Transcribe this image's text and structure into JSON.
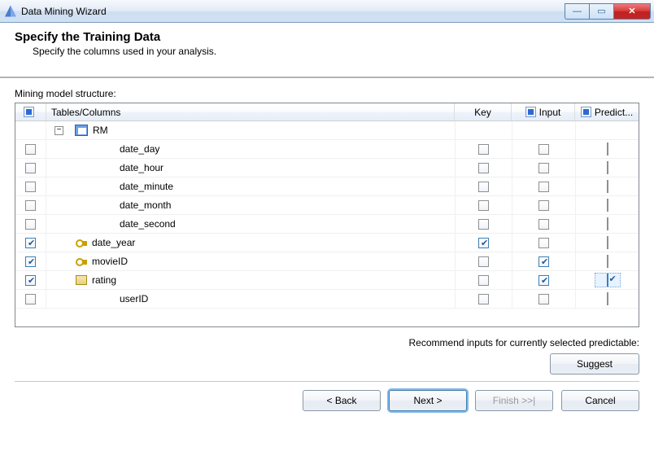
{
  "window": {
    "title": "Data Mining Wizard"
  },
  "header": {
    "title": "Specify the Training Data",
    "subtitle": "Specify the columns used in your analysis."
  },
  "grid": {
    "label": "Mining model structure:",
    "headers": {
      "main": "Tables/Columns",
      "key": "Key",
      "input": "Input",
      "predict": "Predict..."
    },
    "root": {
      "name": "RM"
    },
    "columns": [
      {
        "name": "date_day",
        "sel": false,
        "key": false,
        "input": false,
        "predict": false,
        "icon": "none"
      },
      {
        "name": "date_hour",
        "sel": false,
        "key": false,
        "input": false,
        "predict": false,
        "icon": "none"
      },
      {
        "name": "date_minute",
        "sel": false,
        "key": false,
        "input": false,
        "predict": false,
        "icon": "none"
      },
      {
        "name": "date_month",
        "sel": false,
        "key": false,
        "input": false,
        "predict": false,
        "icon": "none"
      },
      {
        "name": "date_second",
        "sel": false,
        "key": false,
        "input": false,
        "predict": false,
        "icon": "none"
      },
      {
        "name": "date_year",
        "sel": true,
        "key": true,
        "input": false,
        "predict": false,
        "icon": "key"
      },
      {
        "name": "movieID",
        "sel": true,
        "key": false,
        "input": true,
        "predict": false,
        "icon": "key"
      },
      {
        "name": "rating",
        "sel": true,
        "key": false,
        "input": true,
        "predict": true,
        "icon": "col",
        "highlight": true
      },
      {
        "name": "userID",
        "sel": false,
        "key": false,
        "input": false,
        "predict": false,
        "icon": "none"
      }
    ]
  },
  "recommend": {
    "label": "Recommend inputs for currently selected predictable:"
  },
  "buttons": {
    "suggest": "Suggest",
    "back": "< Back",
    "next": "Next >",
    "finish": "Finish >>|",
    "cancel": "Cancel"
  }
}
